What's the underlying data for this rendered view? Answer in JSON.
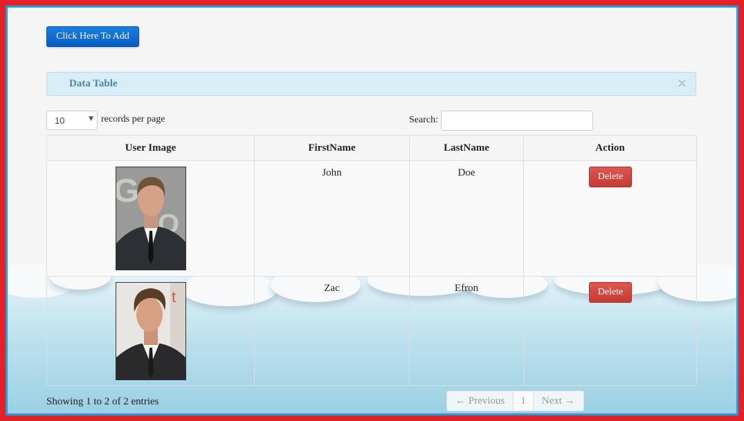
{
  "toolbar": {
    "add_label": "Click Here To Add"
  },
  "panel": {
    "title": "Data Table",
    "close": "×"
  },
  "length_control": {
    "selected": "10",
    "label": "records per page"
  },
  "search": {
    "label": "Search:",
    "value": "",
    "placeholder": ""
  },
  "table": {
    "columns": [
      "User Image",
      "FirstName",
      "LastName",
      "Action"
    ],
    "rows": [
      {
        "first": "John",
        "last": "Doe",
        "action": "Delete"
      },
      {
        "first": "Zac",
        "last": "Efron",
        "action": "Delete"
      }
    ]
  },
  "footer": {
    "info": "Showing 1 to 2 of 2 entries",
    "prev": "← Previous",
    "page": "1",
    "next": "Next →"
  },
  "colors": {
    "outer_border": "#e42028",
    "inner_border": "#1aa1e0",
    "primary_button": "#0a5bc4",
    "danger_button": "#c33b36",
    "panel_bg": "#d9edf6"
  },
  "icons": {
    "close": "close-icon",
    "select_caret": "chevron-down-icon"
  }
}
